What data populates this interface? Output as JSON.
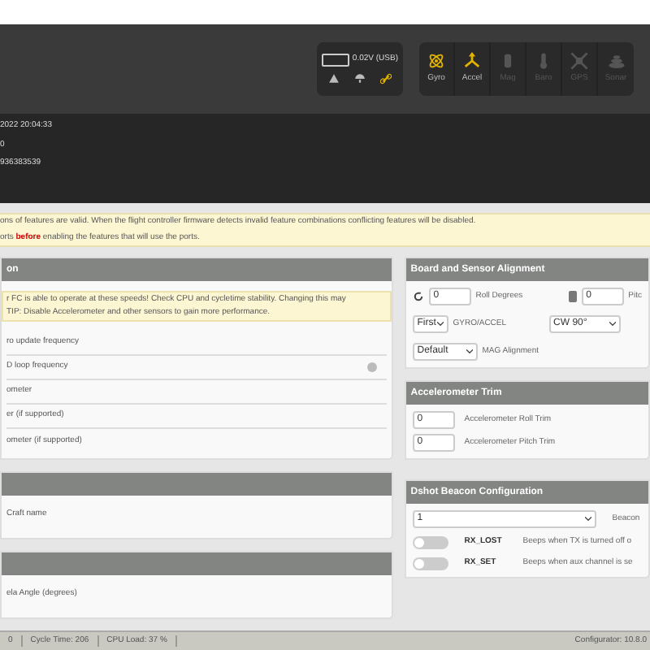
{
  "battery": {
    "reading": "0.02V (USB)",
    "level": 0
  },
  "status_icons": [
    {
      "kind": "warning",
      "active": false
    },
    {
      "kind": "parachute",
      "active": false
    },
    {
      "kind": "link",
      "active": true
    }
  ],
  "sensors": [
    {
      "label": "Gyro",
      "kind": "gyro",
      "active": true
    },
    {
      "label": "Accel",
      "kind": "accel",
      "active": true
    },
    {
      "label": "Mag",
      "kind": "mag",
      "active": false
    },
    {
      "label": "Baro",
      "kind": "baro",
      "active": false
    },
    {
      "label": "GPS",
      "kind": "gps",
      "active": false
    },
    {
      "label": "Sonar",
      "kind": "sonar",
      "active": false
    }
  ],
  "log_lines": [
    "2022 20:04:33",
    "0",
    "936383539"
  ],
  "notice": [
    "ons of features are valid. When the flight controller firmware detects invalid feature combinations conflicting features will be disabled.",
    "orts **before** enabling the features that will use the ports."
  ],
  "left_panels": [
    {
      "title": "on",
      "note": [
        "r FC is able to operate at these speeds! Check CPU and cycletime stability. Changing this may",
        "TIP: Disable Accelerometer and other sensors to gain more performance."
      ],
      "rows": [
        {
          "label": "ro update frequency",
          "help": false
        },
        {
          "label": "D loop frequency",
          "help": true
        },
        {
          "label": "ometer",
          "help": false
        },
        {
          "label": "er (if supported)",
          "help": false
        },
        {
          "label": "ometer (if supported)",
          "help": false
        }
      ]
    },
    {
      "rows": [
        {
          "label": "Craft name",
          "help": false
        }
      ]
    },
    {
      "rows": [
        {
          "label": "ela Angle (degrees)",
          "help": false
        }
      ]
    }
  ],
  "alignment": {
    "title": "Board and Sensor Alignment",
    "roll_value": "0",
    "roll_label": "Roll Degrees",
    "pitch_value": "0",
    "pitch_label": "Pitc",
    "gyro_select": "First",
    "gyro_label": "GYRO/ACCEL",
    "gyro_rotation": "CW 90°",
    "mag_select": "Default",
    "mag_label": "MAG Alignment"
  },
  "trim": {
    "title": "Accelerometer Trim",
    "rows": [
      {
        "value": "0",
        "label": "Accelerometer Roll Trim"
      },
      {
        "value": "0",
        "label": "Accelerometer Pitch Trim"
      }
    ]
  },
  "beacon": {
    "title": "Dshot Beacon Configuration",
    "select": "1",
    "select_label": "Beacon",
    "toggles": [
      {
        "name": "RX_LOST",
        "description": "Beeps when TX is turned off o",
        "on": false
      },
      {
        "name": "RX_SET",
        "description": "Beeps when aux channel is se",
        "on": false
      }
    ]
  },
  "status_bar": {
    "items": [
      "0",
      "Cycle Time: 206",
      "CPU Load: 37 %"
    ],
    "version": "Configurator: 10.8.0"
  }
}
